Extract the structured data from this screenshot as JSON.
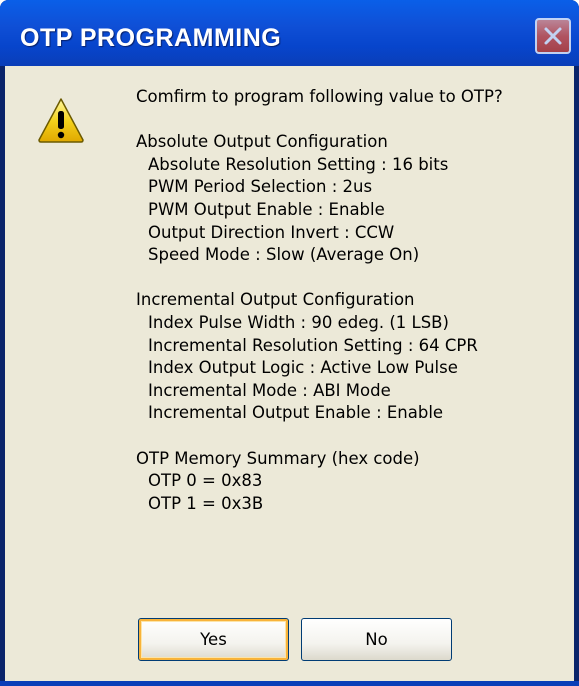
{
  "window": {
    "title": "OTP PROGRAMMING"
  },
  "icons": {
    "warning": "warning-icon",
    "close": "close-icon"
  },
  "colors": {
    "titlebar": "#0a5fe8",
    "dialog_background": "#ece9d8",
    "default_button_highlight": "#f8b33a",
    "warning_yellow": "#f4d21c"
  },
  "message": {
    "prompt": "Comfirm to program following value to OTP?",
    "absolute": {
      "heading": "Absolute Output Configuration",
      "lines": [
        "Absolute Resolution Setting : 16 bits",
        "PWM Period Selection : 2us",
        "PWM Output Enable : Enable",
        "Output Direction Invert : CCW",
        "Speed Mode : Slow (Average On)"
      ]
    },
    "incremental": {
      "heading": "Incremental Output Configuration",
      "lines": [
        "Index Pulse Width : 90 edeg. (1 LSB)",
        "Incremental Resolution Setting : 64 CPR",
        "Index Output Logic : Active Low Pulse",
        "Incremental Mode : ABI Mode",
        "Incremental Output Enable : Enable"
      ]
    },
    "memory": {
      "heading": "OTP Memory Summary (hex code)",
      "lines": [
        "OTP 0 = 0x83",
        "OTP 1 = 0x3B"
      ]
    }
  },
  "buttons": {
    "yes": "Yes",
    "no": "No"
  }
}
